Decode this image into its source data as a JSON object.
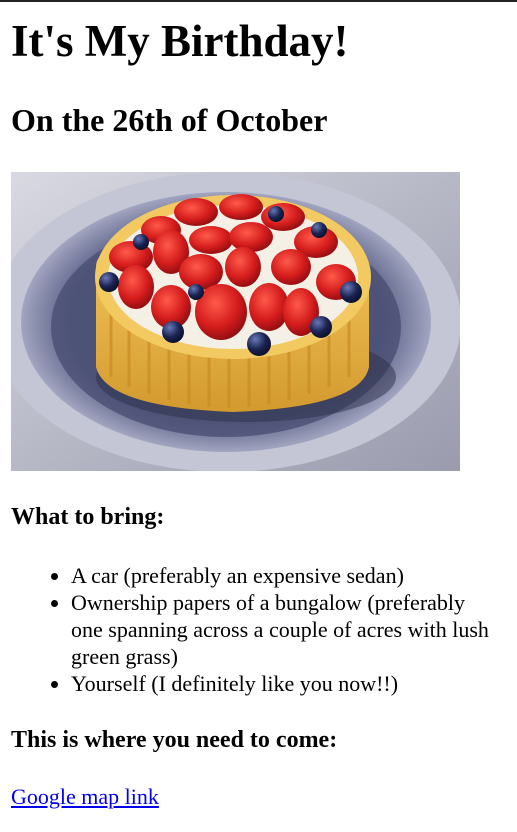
{
  "heading": "It's My Birthday!",
  "subheading": "On the 26th of October",
  "cake_image": {
    "icon": "strawberry-blueberry-tart-image"
  },
  "bring": {
    "title": "What to bring:",
    "items": [
      "A car (preferably an expensive sedan)",
      "Ownership papers of a bungalow (preferably one spanning across a couple of acres with lush green grass)",
      "Yourself (I definitely like you now!!)"
    ]
  },
  "location": {
    "title": "This is where you need to come:",
    "link_text": "Google map link"
  }
}
